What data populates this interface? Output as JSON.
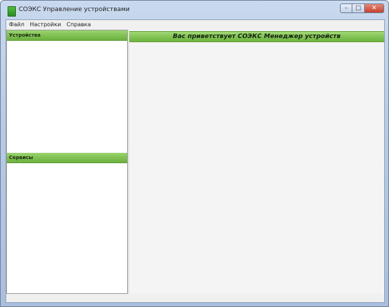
{
  "window": {
    "title": "СОЭКС Управление устройствами",
    "controls": {
      "minimize": "–",
      "maximize": "□",
      "close": "✕"
    }
  },
  "menu": {
    "items": [
      "Файл",
      "Настройки",
      "Справка"
    ]
  },
  "sidebar": {
    "devices_header": "Устройства",
    "services_header": "Сервисы",
    "devices": [],
    "services": []
  },
  "main": {
    "banner": "Вас приветствует СОЭКС Менеджер устройств"
  },
  "colors": {
    "header_green": "#84c556",
    "title_bar": "#b6cbe6",
    "close_red": "#c7412c"
  },
  "icons": {
    "app": "app-icon",
    "minimize": "minimize-icon",
    "maximize": "maximize-icon",
    "close": "close-icon"
  }
}
